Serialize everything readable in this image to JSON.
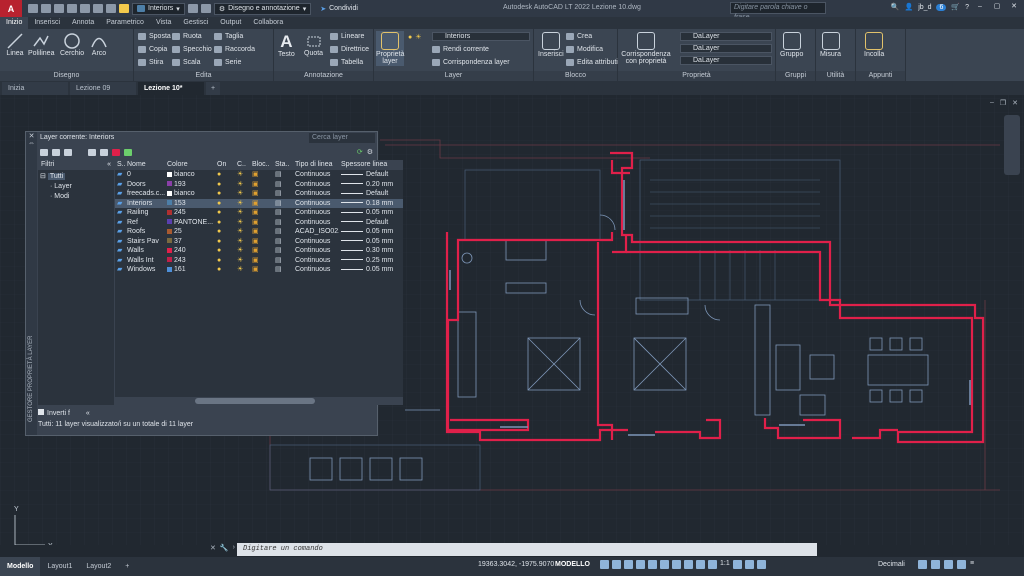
{
  "titlebar": {
    "logo": "A",
    "workspace": "Disegno e annotazione",
    "layer": "Interiors",
    "share": "Condividi",
    "title": "Autodesk AutoCAD LT 2022    Lezione 10.dwg",
    "search_placeholder": "Digitare parola chiave o frase",
    "user": "jb_d",
    "badge": "6"
  },
  "ribbon_tabs": [
    "Inizio",
    "Inserisci",
    "Annota",
    "Parametrico",
    "Vista",
    "Gestisci",
    "Output",
    "Collabora"
  ],
  "ribbon": {
    "disegno": {
      "title": "Disegno",
      "tools": [
        "Linea",
        "Polilinea",
        "Cerchio",
        "Arco"
      ]
    },
    "edita": {
      "title": "Edita",
      "items": [
        "Sposta",
        "Ruota",
        "Taglia",
        "Copia",
        "Specchio",
        "Raccorda",
        "Stira",
        "Scala",
        "Serie"
      ]
    },
    "annotazione": {
      "title": "Annotazione",
      "tools": [
        "Testo",
        "Quota"
      ],
      "items": [
        "Lineare",
        "Direttrice",
        "Tabella"
      ]
    },
    "layer": {
      "title": "Layer",
      "big": "Proprietà layer",
      "current": "Interiors",
      "items": [
        "Rendi corrente",
        "Corrispondenza layer"
      ]
    },
    "blocco": {
      "title": "Blocco",
      "big": "Inserisci",
      "items": [
        "Crea",
        "Modifica",
        "Edita attributi"
      ]
    },
    "proprieta": {
      "title": "Proprietà",
      "big": "Corrispondenza con proprietà",
      "values": [
        "DaLayer",
        "DaLayer",
        "DaLayer"
      ]
    },
    "gruppi": {
      "title": "Gruppi",
      "big": "Gruppo"
    },
    "utilita": {
      "title": "Utilità",
      "big": "Misura"
    },
    "appunti": {
      "title": "Appunti",
      "big": "Incolla"
    }
  },
  "doc_tabs": [
    "Inizia",
    "Lezione 09",
    "Lezione 10*"
  ],
  "layer_panel": {
    "side_label": "GESTORE PROPRIETÀ LAYER",
    "header": "Layer corrente: Interiors",
    "search_placeholder": "Cerca layer",
    "filters_title": "Filtri",
    "tree": [
      "Tutti",
      "Layer",
      "Modi"
    ],
    "invert_label": "Inverti f",
    "columns": [
      "S..",
      "Nome",
      "Colore",
      "On",
      "C..",
      "Bloc..",
      "Sta..",
      "Tipo di linea",
      "Spessore linea"
    ],
    "rows": [
      {
        "name": "0",
        "color": "bianco",
        "hex": "#ffffff",
        "linetype": "Continuous",
        "weight": "Default"
      },
      {
        "name": "Doors",
        "color": "193",
        "hex": "#8a3fa8",
        "linetype": "Continuous",
        "weight": "0.20 mm"
      },
      {
        "name": "freecads.c...",
        "color": "bianco",
        "hex": "#ffffff",
        "linetype": "Continuous",
        "weight": "Default"
      },
      {
        "name": "Interiors",
        "color": "153",
        "hex": "#4d7fa8",
        "linetype": "Continuous",
        "weight": "0.18 mm"
      },
      {
        "name": "Railing",
        "color": "245",
        "hex": "#b03030",
        "linetype": "Continuous",
        "weight": "0.05 mm"
      },
      {
        "name": "Ref",
        "color": "PANTONE...",
        "hex": "#5a3fb0",
        "linetype": "Continuous",
        "weight": "Default"
      },
      {
        "name": "Roofs",
        "color": "25",
        "hex": "#a85a30",
        "linetype": "ACAD_ISO02...",
        "weight": "0.05 mm"
      },
      {
        "name": "Stairs Pav",
        "color": "37",
        "hex": "#7a6a40",
        "linetype": "Continuous",
        "weight": "0.05 mm"
      },
      {
        "name": "Walls",
        "color": "240",
        "hex": "#e0204a",
        "linetype": "Continuous",
        "weight": "0.30 mm"
      },
      {
        "name": "Walls Int",
        "color": "243",
        "hex": "#c02048",
        "linetype": "Continuous",
        "weight": "0.25 mm"
      },
      {
        "name": "Windows",
        "color": "161",
        "hex": "#4d8fd8",
        "linetype": "Continuous",
        "weight": "0.05 mm"
      }
    ],
    "status": "Tutti: 11 layer visualizzato/i su un totale di 11 layer"
  },
  "command_placeholder": "Digitare un comando",
  "status": {
    "tabs": [
      "Modello",
      "Layout1",
      "Layout2"
    ],
    "coords": "19363.3042, -1975.9070",
    "mode": "MODELLO",
    "units": "Decimali",
    "scale": "1:1"
  }
}
